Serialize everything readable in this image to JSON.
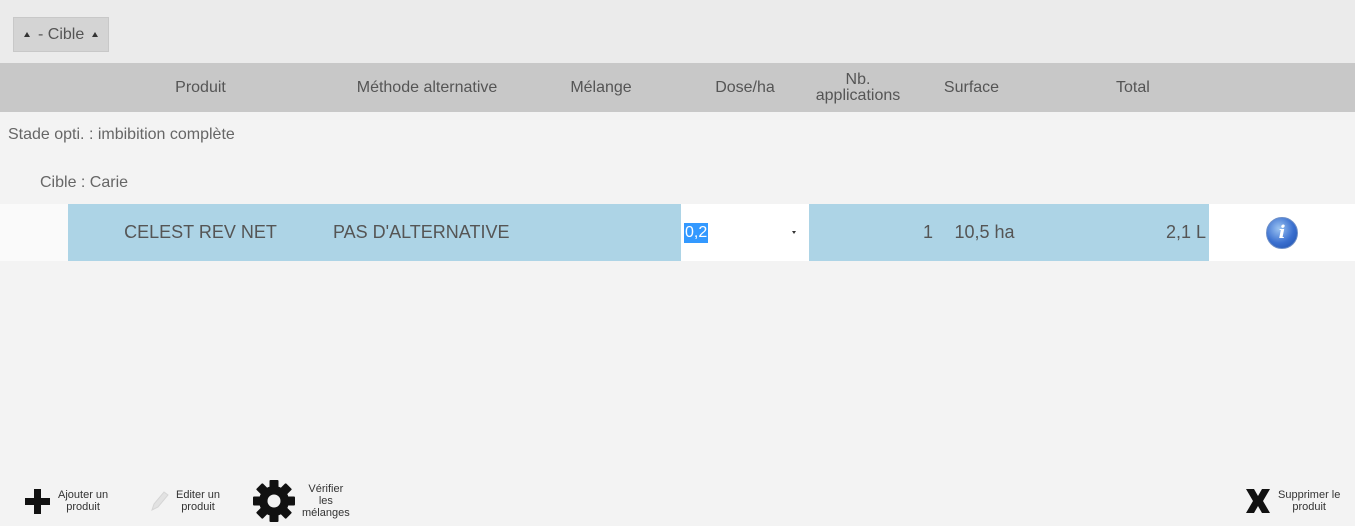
{
  "grouping": {
    "label": "- Cible"
  },
  "columns": {
    "produit": "Produit",
    "methode": "Méthode alternative",
    "melange": "Mélange",
    "dose": "Dose/ha",
    "nb_line1": "Nb.",
    "nb_line2": "applications",
    "surface": "Surface",
    "total": "Total"
  },
  "stade": "Stade opti. : imbibition complète",
  "cible": "Cible : Carie",
  "row": {
    "produit": "CELEST REV NET",
    "methode": "PAS D'ALTERNATIVE",
    "melange": "",
    "dose": "0,2",
    "nb": "1",
    "surface": "10,5 ha",
    "total": "2,1 L"
  },
  "toolbar": {
    "add_line1": "Ajouter un",
    "add_line2": "produit",
    "edit_line1": "Editer un",
    "edit_line2": "produit",
    "verify_line1": "Vérifier",
    "verify_line2": "les",
    "verify_line3": "mélanges",
    "delete_line1": "Supprimer le",
    "delete_line2": "produit"
  },
  "icons": [
    "sort-up-icon",
    "dropdown-arrow-icon",
    "info-icon",
    "plus-icon",
    "pencil-icon",
    "gear-icon",
    "x-icon"
  ],
  "colors": {
    "selected_row": "#add4e6",
    "header": "#c8c8c8",
    "selection": "#3399ff"
  }
}
